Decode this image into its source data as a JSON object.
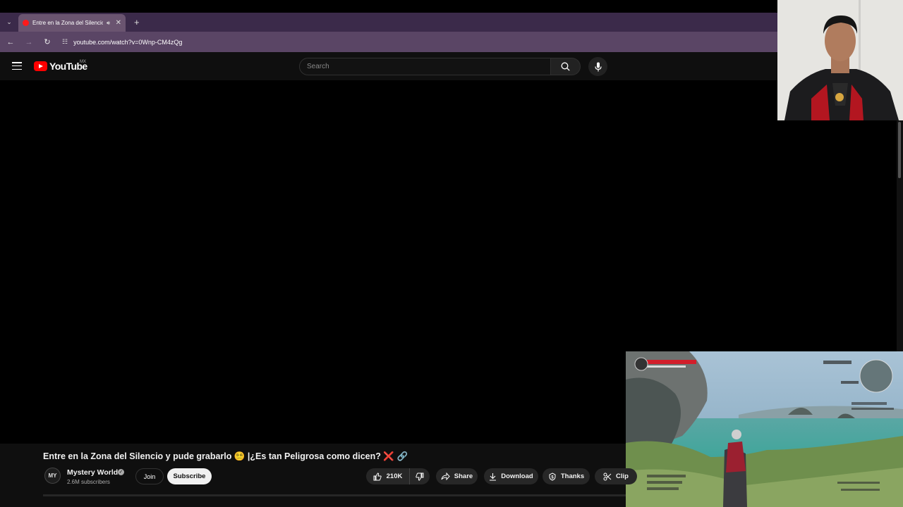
{
  "browser": {
    "tab_title": "Entre en la Zona del Silencio",
    "url": "youtube.com/watch?v=0Wnp-CM4zQg"
  },
  "header": {
    "logo_text": "YouTube",
    "country_code": "MX",
    "search_placeholder": "Search"
  },
  "video": {
    "title": "Entre en la Zona del Silencio y pude grabarlo 😵‍💫 |¿Es tan Peligrosa como dicen?",
    "title_x": "❌",
    "title_link": "🔗",
    "channel_initials": "MY",
    "channel_name": "Mystery World",
    "subscribers": "2.6M subscribers",
    "join_label": "Join",
    "subscribe_label": "Subscribe",
    "likes": "210K",
    "share_label": "Share",
    "download_label": "Download",
    "thanks_label": "Thanks",
    "clip_label": "Clip"
  },
  "colors": {
    "tabbar": "#3b2a4a",
    "addressbar": "#5a4565",
    "youtube_red": "#ff0000",
    "background": "#0f0f0f"
  }
}
